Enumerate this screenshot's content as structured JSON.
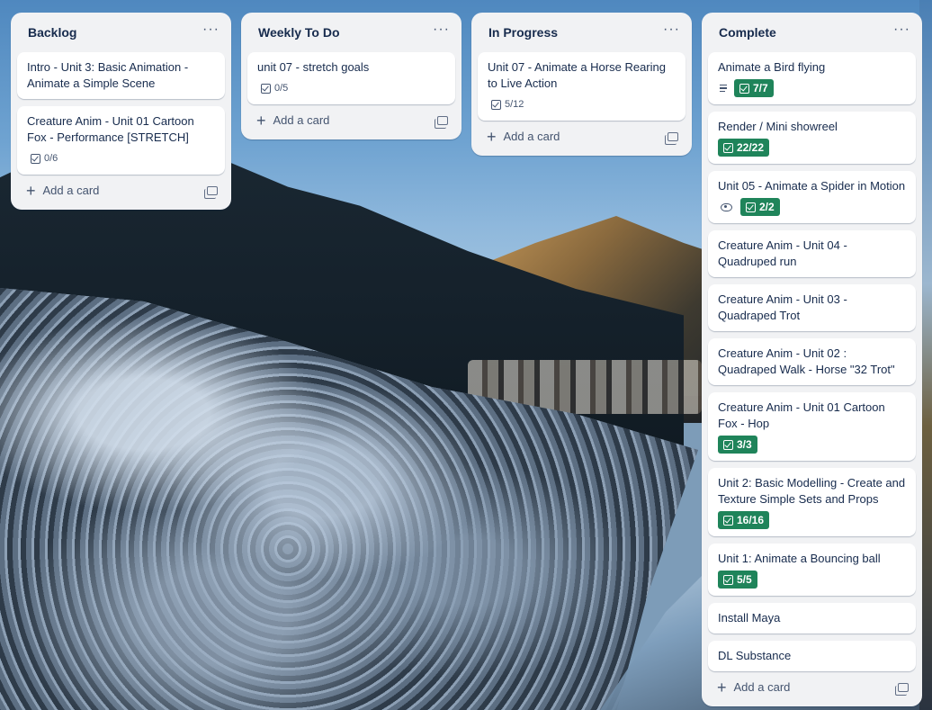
{
  "lists": [
    {
      "title": "Backlog",
      "menu": "···",
      "cards": [
        {
          "title": "Intro - Unit 3: Basic Animation - Animate a Simple Scene"
        },
        {
          "title": "Creature Anim - Unit 01 Cartoon Fox - Performance [STRETCH]",
          "checklist": "0/6"
        }
      ],
      "add_label": "Add a card"
    },
    {
      "title": "Weekly To Do",
      "menu": "···",
      "cards": [
        {
          "title": "unit 07 - stretch goals",
          "checklist": "0/5"
        }
      ],
      "add_label": "Add a card"
    },
    {
      "title": "In Progress",
      "menu": "···",
      "cards": [
        {
          "title": "Unit 07 - Animate a Horse Rearing to Live Action",
          "checklist": "5/12"
        }
      ],
      "add_label": "Add a card"
    },
    {
      "title": "Complete",
      "menu": "···",
      "cards": [
        {
          "title": "Animate a Bird flying",
          "description_icon": "description-icon",
          "checklist_complete": "7/7"
        },
        {
          "title": "Render / Mini showreel",
          "checklist_complete": "22/22"
        },
        {
          "title": "Unit 05 - Animate a Spider in Motion",
          "watch_icon": "eye-icon",
          "checklist_complete": "2/2"
        },
        {
          "title": "Creature Anim - Unit 04 - Quadruped run"
        },
        {
          "title": "Creature Anim - Unit 03 - Quadraped Trot"
        },
        {
          "title": "Creature Anim - Unit 02 : Quadraped Walk - Horse \"32 Trot\""
        },
        {
          "title": "Creature Anim - Unit 01 Cartoon Fox - Hop",
          "checklist_complete": "3/3"
        },
        {
          "title": "Unit 2: Basic Modelling - Create and Texture Simple Sets and Props",
          "checklist_complete": "16/16"
        },
        {
          "title": "Unit 1: Animate a Bouncing ball",
          "checklist_complete": "5/5"
        },
        {
          "title": "Install Maya"
        },
        {
          "title": "DL Substance"
        }
      ],
      "add_label": "Add a card"
    }
  ],
  "colors": {
    "list_bg": "#f1f2f4",
    "card_bg": "#ffffff",
    "complete_badge": "#1f845a",
    "text": "#172b4d"
  }
}
